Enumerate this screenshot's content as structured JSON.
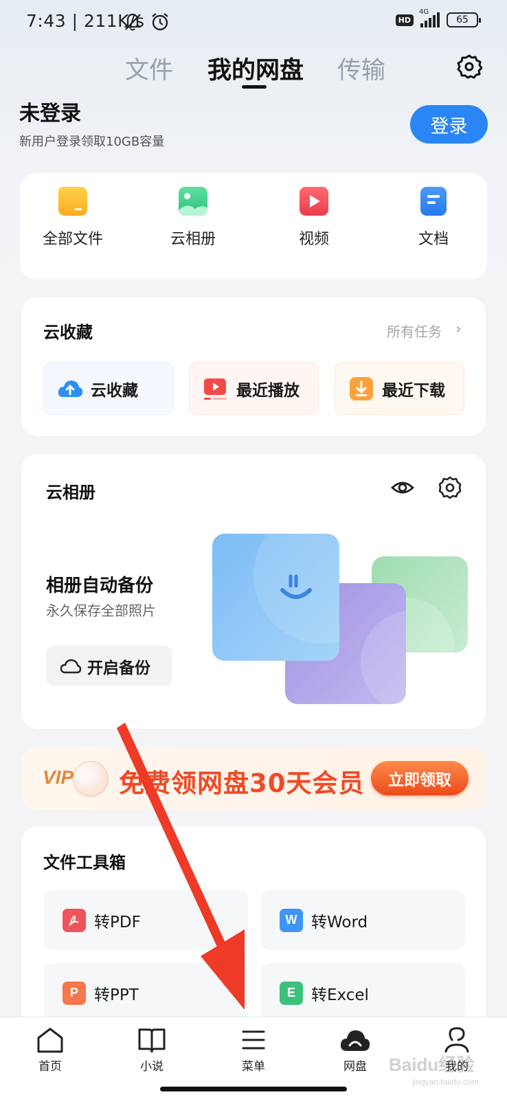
{
  "status_bar": {
    "time": "7:43 | 211K/s",
    "hd": "HD",
    "network": "4G",
    "battery": "65"
  },
  "tabs": [
    {
      "label": "文件",
      "active": false
    },
    {
      "label": "我的网盘",
      "active": true
    },
    {
      "label": "传输",
      "active": false
    }
  ],
  "account": {
    "title": "未登录",
    "subtitle": "新用户登录领取10GB容量",
    "login_label": "登录"
  },
  "categories": [
    {
      "label": "全部文件",
      "icon": "folder-icon",
      "color": "#fbb62a"
    },
    {
      "label": "云相册",
      "icon": "photo-album-icon",
      "color": "#3ccf8a"
    },
    {
      "label": "视频",
      "icon": "video-icon",
      "color": "#f04b5a"
    },
    {
      "label": "文档",
      "icon": "document-icon",
      "color": "#2f82f2"
    }
  ],
  "favorites": {
    "title": "云收藏",
    "all_tasks": "所有任务",
    "items": [
      {
        "label": "云收藏",
        "icon": "cloud-upload-icon",
        "color": "#2a8cf5"
      },
      {
        "label": "最近播放",
        "icon": "recent-play-icon",
        "color": "#f04a4a"
      },
      {
        "label": "最近下载",
        "icon": "download-icon",
        "color": "#f7a13a"
      }
    ]
  },
  "album": {
    "title": "云相册",
    "backup_title": "相册自动备份",
    "backup_subtitle": "永久保存全部照片",
    "backup_button": "开启备份"
  },
  "vip_banner": {
    "badge": "VIP",
    "text": "免费领网盘30天会员",
    "button": "立即领取"
  },
  "tools": {
    "title": "文件工具箱",
    "items": [
      {
        "label": "转PDF",
        "glyph": "A",
        "color": "#f0545a"
      },
      {
        "label": "转Word",
        "glyph": "W",
        "color": "#3d96f5"
      },
      {
        "label": "转PPT",
        "glyph": "P",
        "color": "#f7764a"
      },
      {
        "label": "转Excel",
        "glyph": "E",
        "color": "#3cc07a"
      }
    ]
  },
  "bottom_nav": [
    {
      "label": "首页",
      "icon": "home-icon"
    },
    {
      "label": "小说",
      "icon": "book-icon"
    },
    {
      "label": "菜单",
      "icon": "menu-icon"
    },
    {
      "label": "网盘",
      "icon": "cloud-drive-icon"
    },
    {
      "label": "我的",
      "icon": "profile-icon"
    }
  ],
  "watermark": {
    "brand": "Baidu经验",
    "url": "jingyan.baidu.com"
  },
  "colors": {
    "accent": "#2a86f5",
    "annotation_arrow": "#ee3a26"
  }
}
